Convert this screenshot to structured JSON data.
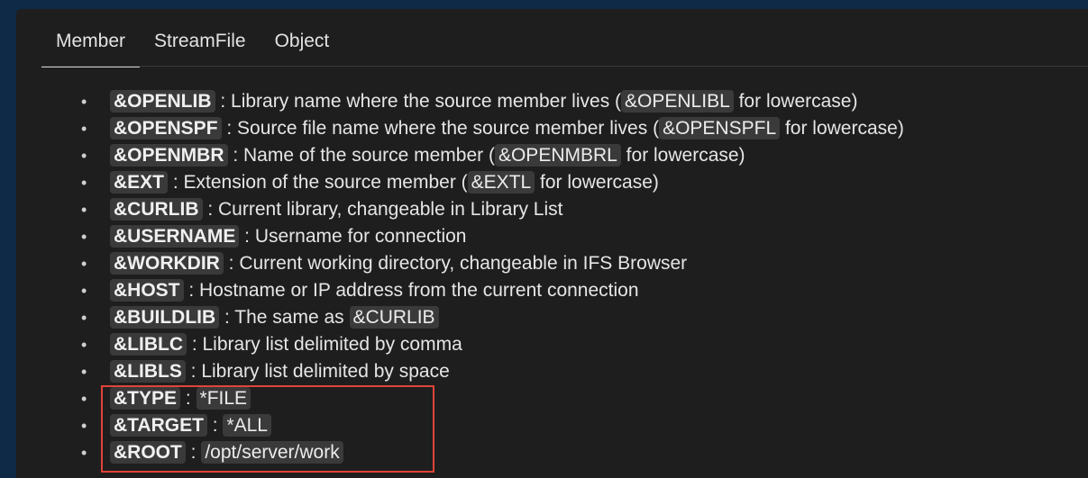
{
  "tabs": [
    {
      "label": "Member",
      "active": true
    },
    {
      "label": "StreamFile",
      "active": false
    },
    {
      "label": "Object",
      "active": false
    }
  ],
  "variables": [
    {
      "name": "&OPENLIB",
      "desc_before": " : Library name where the source member lives (",
      "alt": "&OPENLIBL",
      "desc_after": " for lowercase)"
    },
    {
      "name": "&OPENSPF",
      "desc_before": " : Source file name where the source member lives (",
      "alt": "&OPENSPFL",
      "desc_after": " for lowercase)"
    },
    {
      "name": "&OPENMBR",
      "desc_before": " : Name of the source member (",
      "alt": "&OPENMBRL",
      "desc_after": " for lowercase)"
    },
    {
      "name": "&EXT",
      "desc_before": " : Extension of the source member (",
      "alt": "&EXTL",
      "desc_after": " for lowercase)"
    },
    {
      "name": "&CURLIB",
      "desc_before": " : Current library, changeable in Library List",
      "alt": "",
      "desc_after": ""
    },
    {
      "name": "&USERNAME",
      "desc_before": " : Username for connection",
      "alt": "",
      "desc_after": ""
    },
    {
      "name": "&WORKDIR",
      "desc_before": " : Current working directory, changeable in IFS Browser",
      "alt": "",
      "desc_after": ""
    },
    {
      "name": "&HOST",
      "desc_before": " : Hostname or IP address from the current connection",
      "alt": "",
      "desc_after": ""
    },
    {
      "name": "&BUILDLIB",
      "desc_before": " : The same as ",
      "alt": "&CURLIB",
      "desc_after": ""
    },
    {
      "name": "&LIBLC",
      "desc_before": " : Library list delimited by comma",
      "alt": "",
      "desc_after": ""
    },
    {
      "name": "&LIBLS",
      "desc_before": " : Library list delimited by space",
      "alt": "",
      "desc_after": ""
    },
    {
      "name": "&TYPE",
      "desc_before": " : ",
      "alt": "*FILE",
      "desc_after": ""
    },
    {
      "name": "&TARGET",
      "desc_before": " : ",
      "alt": "*ALL",
      "desc_after": ""
    },
    {
      "name": "&ROOT",
      "desc_before": " : ",
      "alt": "/opt/server/work",
      "desc_after": ""
    }
  ],
  "bullet_char": "•",
  "colors": {
    "highlight_border": "#e0443a",
    "panel_bg": "#1e1e1e",
    "code_bg": "#3a3a3a"
  }
}
